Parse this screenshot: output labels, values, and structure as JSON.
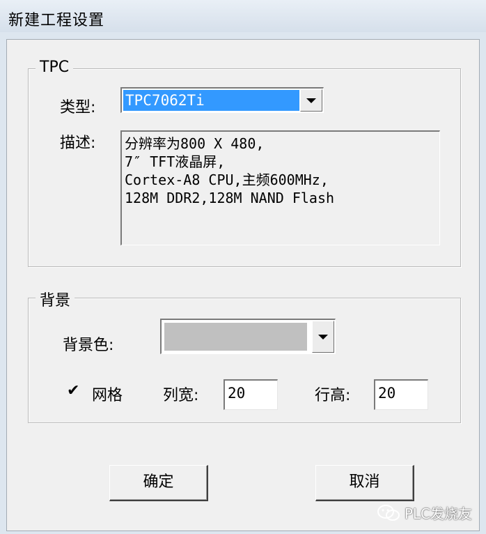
{
  "window": {
    "title": "新建工程设置"
  },
  "tpc_group": {
    "legend": "TPC",
    "type_label": "类型:",
    "type_value": "TPC7062Ti",
    "desc_label": "描述:",
    "desc_lines": [
      "分辨率为800 X 480,",
      "7″ TFT液晶屏,",
      "Cortex-A8 CPU,主频600MHz,",
      "128M DDR2,128M NAND Flash"
    ]
  },
  "bg_group": {
    "legend": "背景",
    "color_label": "背景色:",
    "color_value": "#c0c0c0",
    "grid_checked": true,
    "grid_check_mark": "✔",
    "grid_label": "网格",
    "col_width_label": "列宽:",
    "col_width_value": "20",
    "row_height_label": "行高:",
    "row_height_value": "20"
  },
  "buttons": {
    "ok": "确定",
    "cancel": "取消"
  },
  "watermark": {
    "text": "PLC发烧友"
  }
}
